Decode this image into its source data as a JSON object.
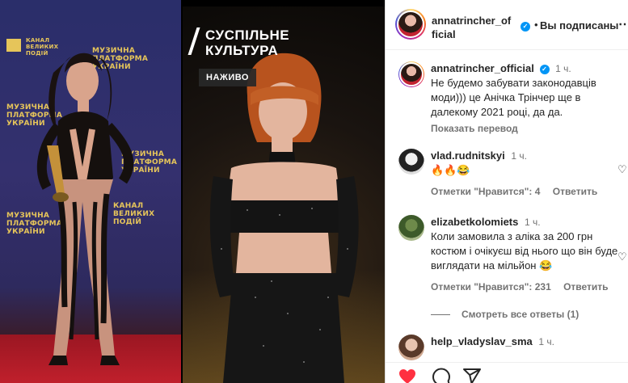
{
  "media": {
    "left_wall_lines": [
      "МУЗИЧНА",
      "ПЛАТФОРМА",
      "УКРАЇНИ"
    ],
    "left_wall_logo_lines": [
      "КАНАЛ",
      "ВЕЛИКИХ",
      "ПОДІЙ"
    ],
    "broadcast_logo_line1": "СУСПІЛЬНЕ",
    "broadcast_logo_line2": "КУЛЬТУРА",
    "live_badge": "НАЖИВО"
  },
  "header": {
    "username_line1": "annatrincher_of",
    "username_line2": "ficial",
    "separator": "•",
    "follow_status": "Вы подписаны",
    "more_icon": "more-horizontal-icon"
  },
  "caption": {
    "username": "annatrincher_official",
    "time": "1 ч.",
    "text": "Не будемо забувати законодавців моди))) це Анічка Трінчер ще в далекому 2021 році, да да.",
    "translate": "Показать перевод"
  },
  "comments": [
    {
      "username": "vlad.rudnitskyi",
      "time": "1 ч.",
      "text": "🔥🔥😂",
      "likes": "Отметки \"Нравится\": 4",
      "reply": "Ответить"
    },
    {
      "username": "elizabetkolomiets",
      "time": "1 ч.",
      "text": "Коли замовила з аліка за 200 грн костюм і очікуєш від нього що він буде виглядати на мільйон 😂",
      "likes": "Отметки \"Нравится\": 231",
      "reply": "Ответить"
    },
    {
      "username": "help_vladyslav_sma",
      "time": "1 ч."
    }
  ],
  "view_replies": "Смотреть все ответы (1)",
  "actions": {
    "like_icon": "heart-filled-icon",
    "comment_icon": "comment-icon",
    "share_icon": "share-icon",
    "like_color": "#ff3040"
  },
  "colors": {
    "verified": "#0095f6",
    "secondary_text": "#737373"
  }
}
